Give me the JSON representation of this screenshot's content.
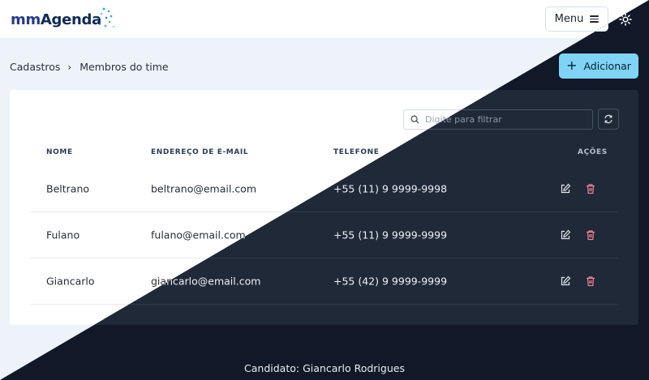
{
  "app": {
    "logo_mm": "mm",
    "logo_name": "Agenda"
  },
  "header": {
    "menu_label": "Menu"
  },
  "breadcrumb": {
    "parent": "Cadastros",
    "separator": "›",
    "current": "Membros do time"
  },
  "toolbar": {
    "add_label": "Adicionar"
  },
  "search": {
    "placeholder": "Digite para filtrar"
  },
  "table": {
    "columns": {
      "name": "NOME",
      "email": "ENDEREÇO DE E-MAIL",
      "phone": "TELEFONE",
      "actions": "AÇÕES"
    },
    "rows": [
      {
        "name": "Beltrano",
        "email": "beltrano@email.com",
        "phone": "+55 (11) 9 9999-9998"
      },
      {
        "name": "Fulano",
        "email": "fulano@email.com",
        "phone": "+55 (11) 9 9999-9999"
      },
      {
        "name": "Giancarlo",
        "email": "giancarlo@email.com",
        "phone": "+55 (42) 9 9999-9999"
      }
    ]
  },
  "footer": {
    "text": "Candidato: Giancarlo Rodrigues"
  },
  "colors": {
    "accent": "#7fd3f5",
    "edit_light": "#3a4657",
    "edit_dark": "#e3e7ee",
    "delete_light": "#e0485f",
    "delete_dark": "#f08696",
    "dark_bg": "#111827",
    "dark_card": "#1f2937",
    "light_bg": "#eef2f9"
  },
  "icons": {
    "logo_decoration": "dotted-sparkle",
    "menu": "hamburger-icon",
    "theme": "sun-icon",
    "add": "plus-icon",
    "search": "magnifier-icon",
    "refresh": "refresh-icon",
    "edit": "pencil-square-icon",
    "delete": "trash-icon"
  }
}
